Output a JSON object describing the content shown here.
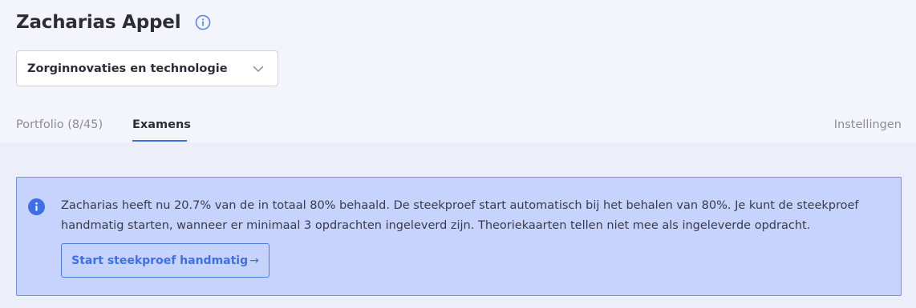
{
  "header": {
    "title": "Zacharias Appel",
    "info_icon": "info-circle-icon"
  },
  "select": {
    "value": "Zorginnovaties en technologie",
    "icon": "chevron-down-icon"
  },
  "tabs": [
    {
      "label": "Portfolio (8/45)",
      "active": false
    },
    {
      "label": "Examens",
      "active": true
    },
    {
      "label": "Instellingen",
      "active": false
    }
  ],
  "alert": {
    "icon": "info-circle-filled-icon",
    "text": "Zacharias heeft nu 20.7% van de in totaal 80% behaald. De steekproef start automatisch bij het behalen van 80%. Je kunt de steekproef handmatig starten, wanneer er minimaal 3 opdrachten ingeleverd zijn. Theoriekaarten tellen niet mee als ingeleverde opdracht.",
    "button_label": "Start steekproef handmatig",
    "button_arrow": "→"
  },
  "colors": {
    "accent": "#3f6fe6",
    "alert_bg": "#c6d3fc",
    "alert_border": "#6f93ee",
    "page_bg": "#f4f5fc"
  }
}
